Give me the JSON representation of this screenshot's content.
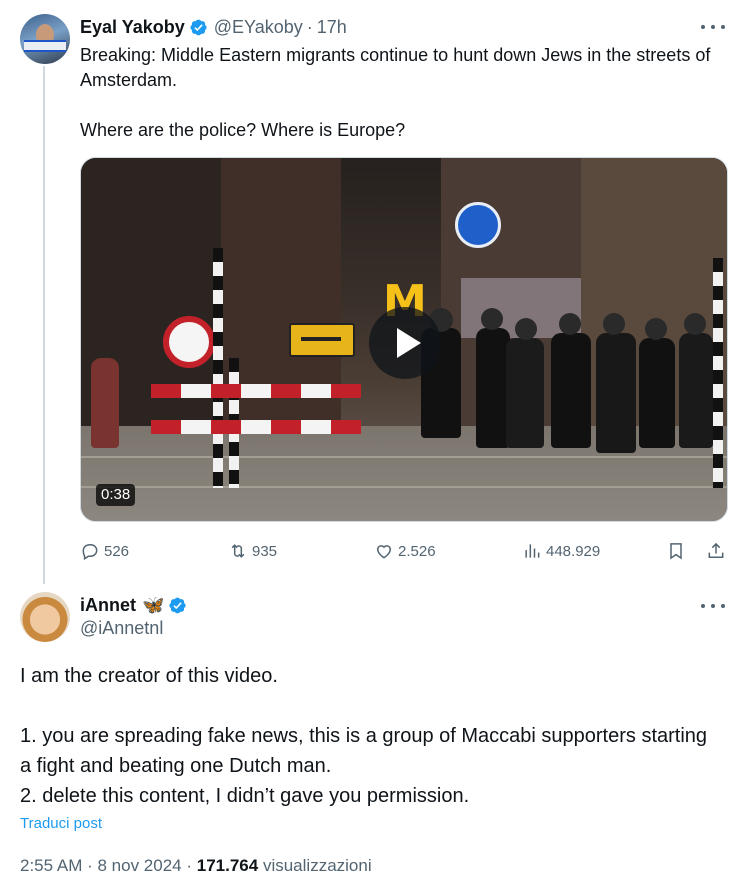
{
  "tweet1": {
    "author_name": "Eyal Yakoby",
    "handle": "@EYakoby",
    "separator": "·",
    "time": "17h",
    "text_line1": "Breaking: Middle Eastern migrants continue to hunt down Jews in the streets of Amsterdam.",
    "text_line2": "Where are the police? Where is Europe?",
    "video_duration": "0:38",
    "replies": "526",
    "reposts": "935",
    "likes": "2.526",
    "views": "448.929"
  },
  "tweet2": {
    "author_name": "iAnnet",
    "emoji": "🦋",
    "handle": "@iAnnetnl",
    "line1": "I am the creator of this video.",
    "line2": "1. you are spreading fake news, this is a group of Maccabi supporters starting a fight and beating one Dutch man.",
    "line3": "2. delete this content, I didn’t gave you permission.",
    "translate_label": "Traduci post",
    "time": "2:55 AM",
    "date": "8 nov 2024",
    "views_count": "171.764",
    "views_label": "visualizzazioni"
  },
  "colors": {
    "text_primary": "#0f1419",
    "text_secondary": "#536471",
    "accent_blue": "#1d9bf0",
    "thread_line": "#cfd9de"
  }
}
